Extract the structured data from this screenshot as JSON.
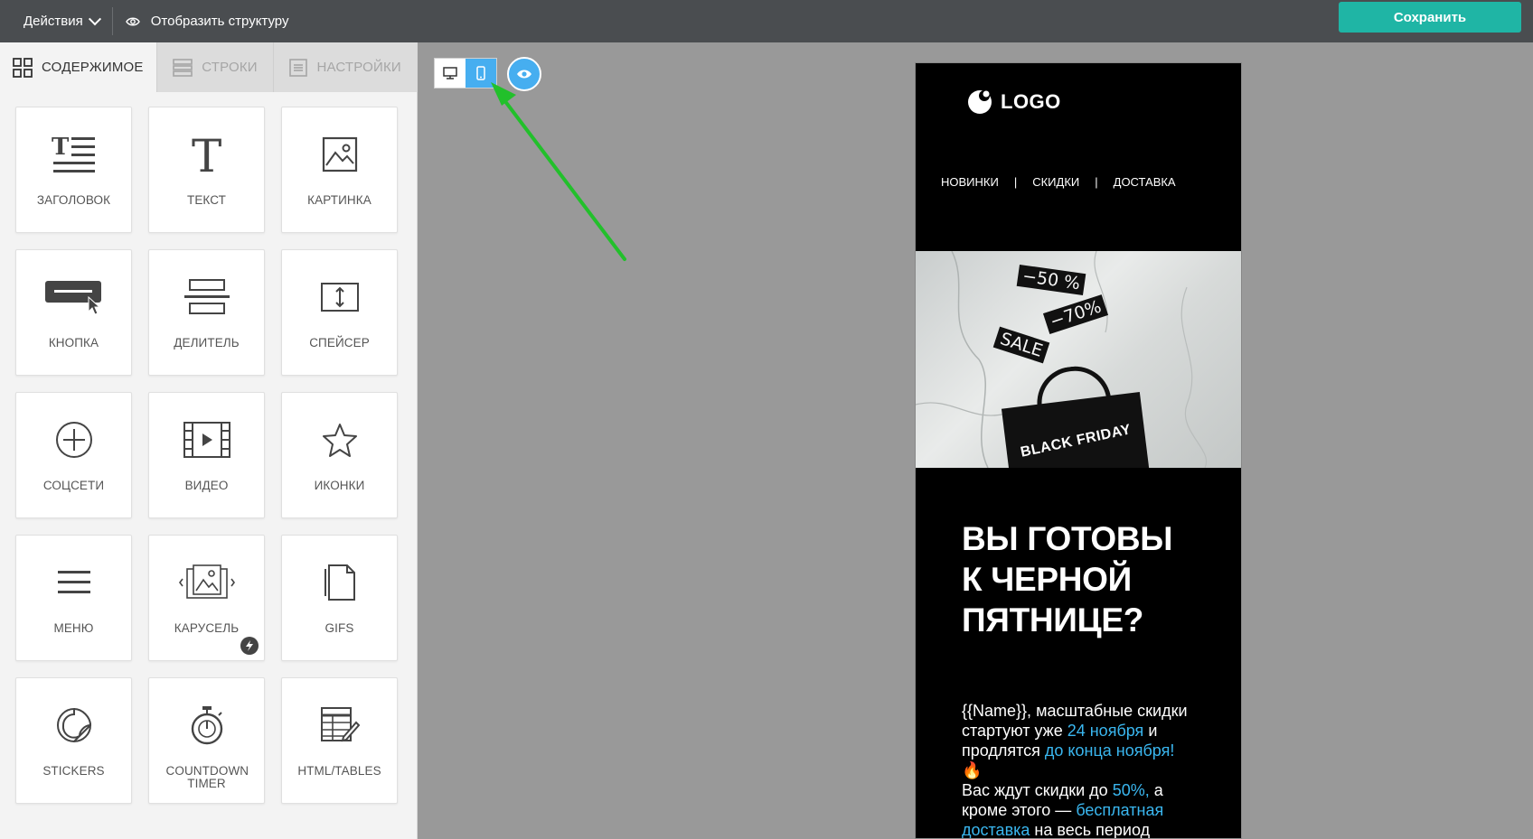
{
  "topbar": {
    "actions_label": "Действия",
    "structure_label": "Отобразить структуру",
    "save_label": "Сохранить"
  },
  "sidebar": {
    "tabs": [
      {
        "label": "СОДЕРЖИМОЕ",
        "icon": "grid-icon",
        "active": true
      },
      {
        "label": "СТРОКИ",
        "icon": "rows-icon",
        "active": false
      },
      {
        "label": "НАСТРОЙКИ",
        "icon": "settings-panel-icon",
        "active": false
      }
    ],
    "blocks": [
      {
        "label": "ЗАГОЛОВОК",
        "icon": "heading-icon"
      },
      {
        "label": "ТЕКСТ",
        "icon": "text-icon"
      },
      {
        "label": "КАРТИНКА",
        "icon": "image-icon"
      },
      {
        "label": "КНОПКА",
        "icon": "button-icon"
      },
      {
        "label": "ДЕЛИТЕЛЬ",
        "icon": "divider-icon"
      },
      {
        "label": "СПЕЙСЕР",
        "icon": "spacer-icon"
      },
      {
        "label": "СОЦСЕТИ",
        "icon": "social-plus-icon"
      },
      {
        "label": "ВИДЕО",
        "icon": "video-icon"
      },
      {
        "label": "ИКОНКИ",
        "icon": "star-icon"
      },
      {
        "label": "МЕНЮ",
        "icon": "menu-icon"
      },
      {
        "label": "КАРУСЕЛЬ",
        "icon": "carousel-icon"
      },
      {
        "label": "GIFS",
        "icon": "gif-file-icon"
      },
      {
        "label": "STICKERS",
        "icon": "sticker-icon"
      },
      {
        "label": "COUNTDOWN TIMER",
        "icon": "stopwatch-icon"
      },
      {
        "label": "HTML/TABLES",
        "icon": "html-table-icon"
      }
    ]
  },
  "canvas": {
    "view_modes": [
      {
        "name": "desktop",
        "icon": "desktop-icon",
        "active": false
      },
      {
        "name": "mobile",
        "icon": "mobile-icon",
        "active": true
      }
    ],
    "preview_icon": "eye-icon",
    "annotation_arrow_color": "#22c02b"
  },
  "email": {
    "logo_text": "LOGO",
    "nav": [
      "НОВИНКИ",
      "СКИДКИ",
      "ДОСТАВКА"
    ],
    "nav_separator": "|",
    "hero_tags": [
      "−50 %",
      "−70%",
      "SALE"
    ],
    "bag_text": "BLACK FRIDAY",
    "headline_lines": [
      "ВЫ ГОТОВЫ",
      "К ЧЕРНОЙ",
      "ПЯТНИЦЕ?"
    ],
    "body": {
      "p1": "{{Name}}, масштабные скидки стартуют уже ",
      "h1": "24 ноября",
      "p2": " и продлятся ",
      "h2": "до конца ноября!",
      "emoji": "🔥",
      "p3": "Вас ждут скидки до ",
      "h3": "50%,",
      "p4": " а кроме этого — ",
      "h4": "бесплатная доставка",
      "p5": " на весь период скидок!"
    },
    "highlight_color": "#3ab7f0"
  },
  "colors": {
    "topbar": "#4a4d50",
    "save": "#1fb5a5",
    "accent": "#46aef0"
  }
}
